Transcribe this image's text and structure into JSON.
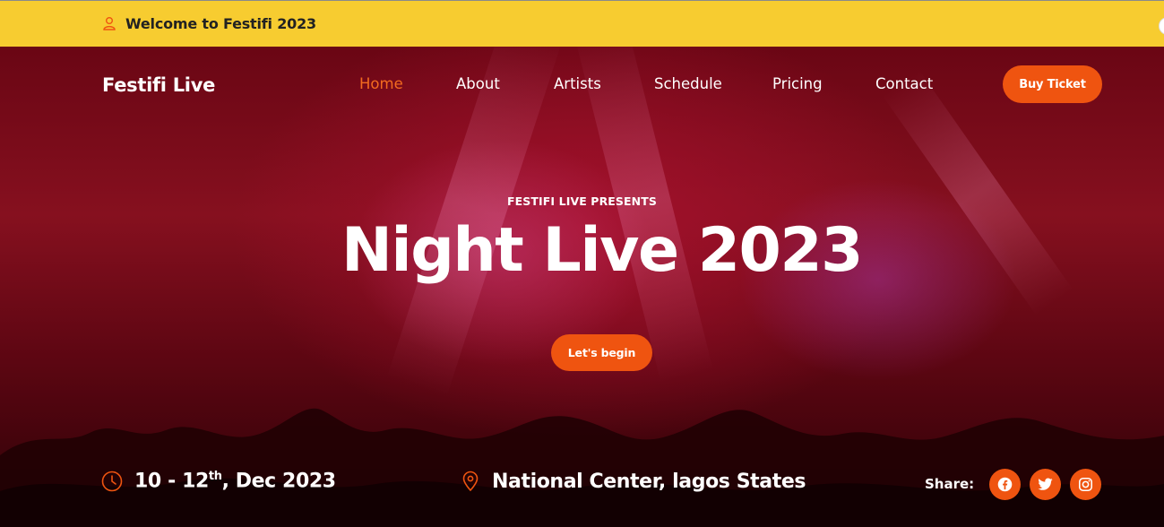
{
  "topbar": {
    "welcome": "Welcome to Festifi 2023",
    "icon": "user-icon"
  },
  "header": {
    "brand": "Festifi Live",
    "nav": [
      {
        "label": "Home",
        "active": true
      },
      {
        "label": "About",
        "active": false
      },
      {
        "label": "Artists",
        "active": false
      },
      {
        "label": "Schedule",
        "active": false
      },
      {
        "label": "Pricing",
        "active": false
      },
      {
        "label": "Contact",
        "active": false
      }
    ],
    "cta": "Buy Ticket"
  },
  "hero": {
    "eyebrow": "FESTIFI LIVE PRESENTS",
    "title": "Night Live 2023",
    "button": "Let's begin"
  },
  "event": {
    "date_prefix": "10 - 12",
    "date_sup": "th",
    "date_suffix": ", Dec 2023",
    "date_icon": "clock-icon",
    "location": "National Center, lagos States",
    "location_icon": "map-pin-icon"
  },
  "share": {
    "label": "Share:",
    "networks": [
      "facebook-icon",
      "twitter-icon",
      "instagram-icon"
    ]
  },
  "colors": {
    "accent": "#ef5410",
    "topbar": "#f7cc30",
    "nav_active": "#f36b1f"
  }
}
